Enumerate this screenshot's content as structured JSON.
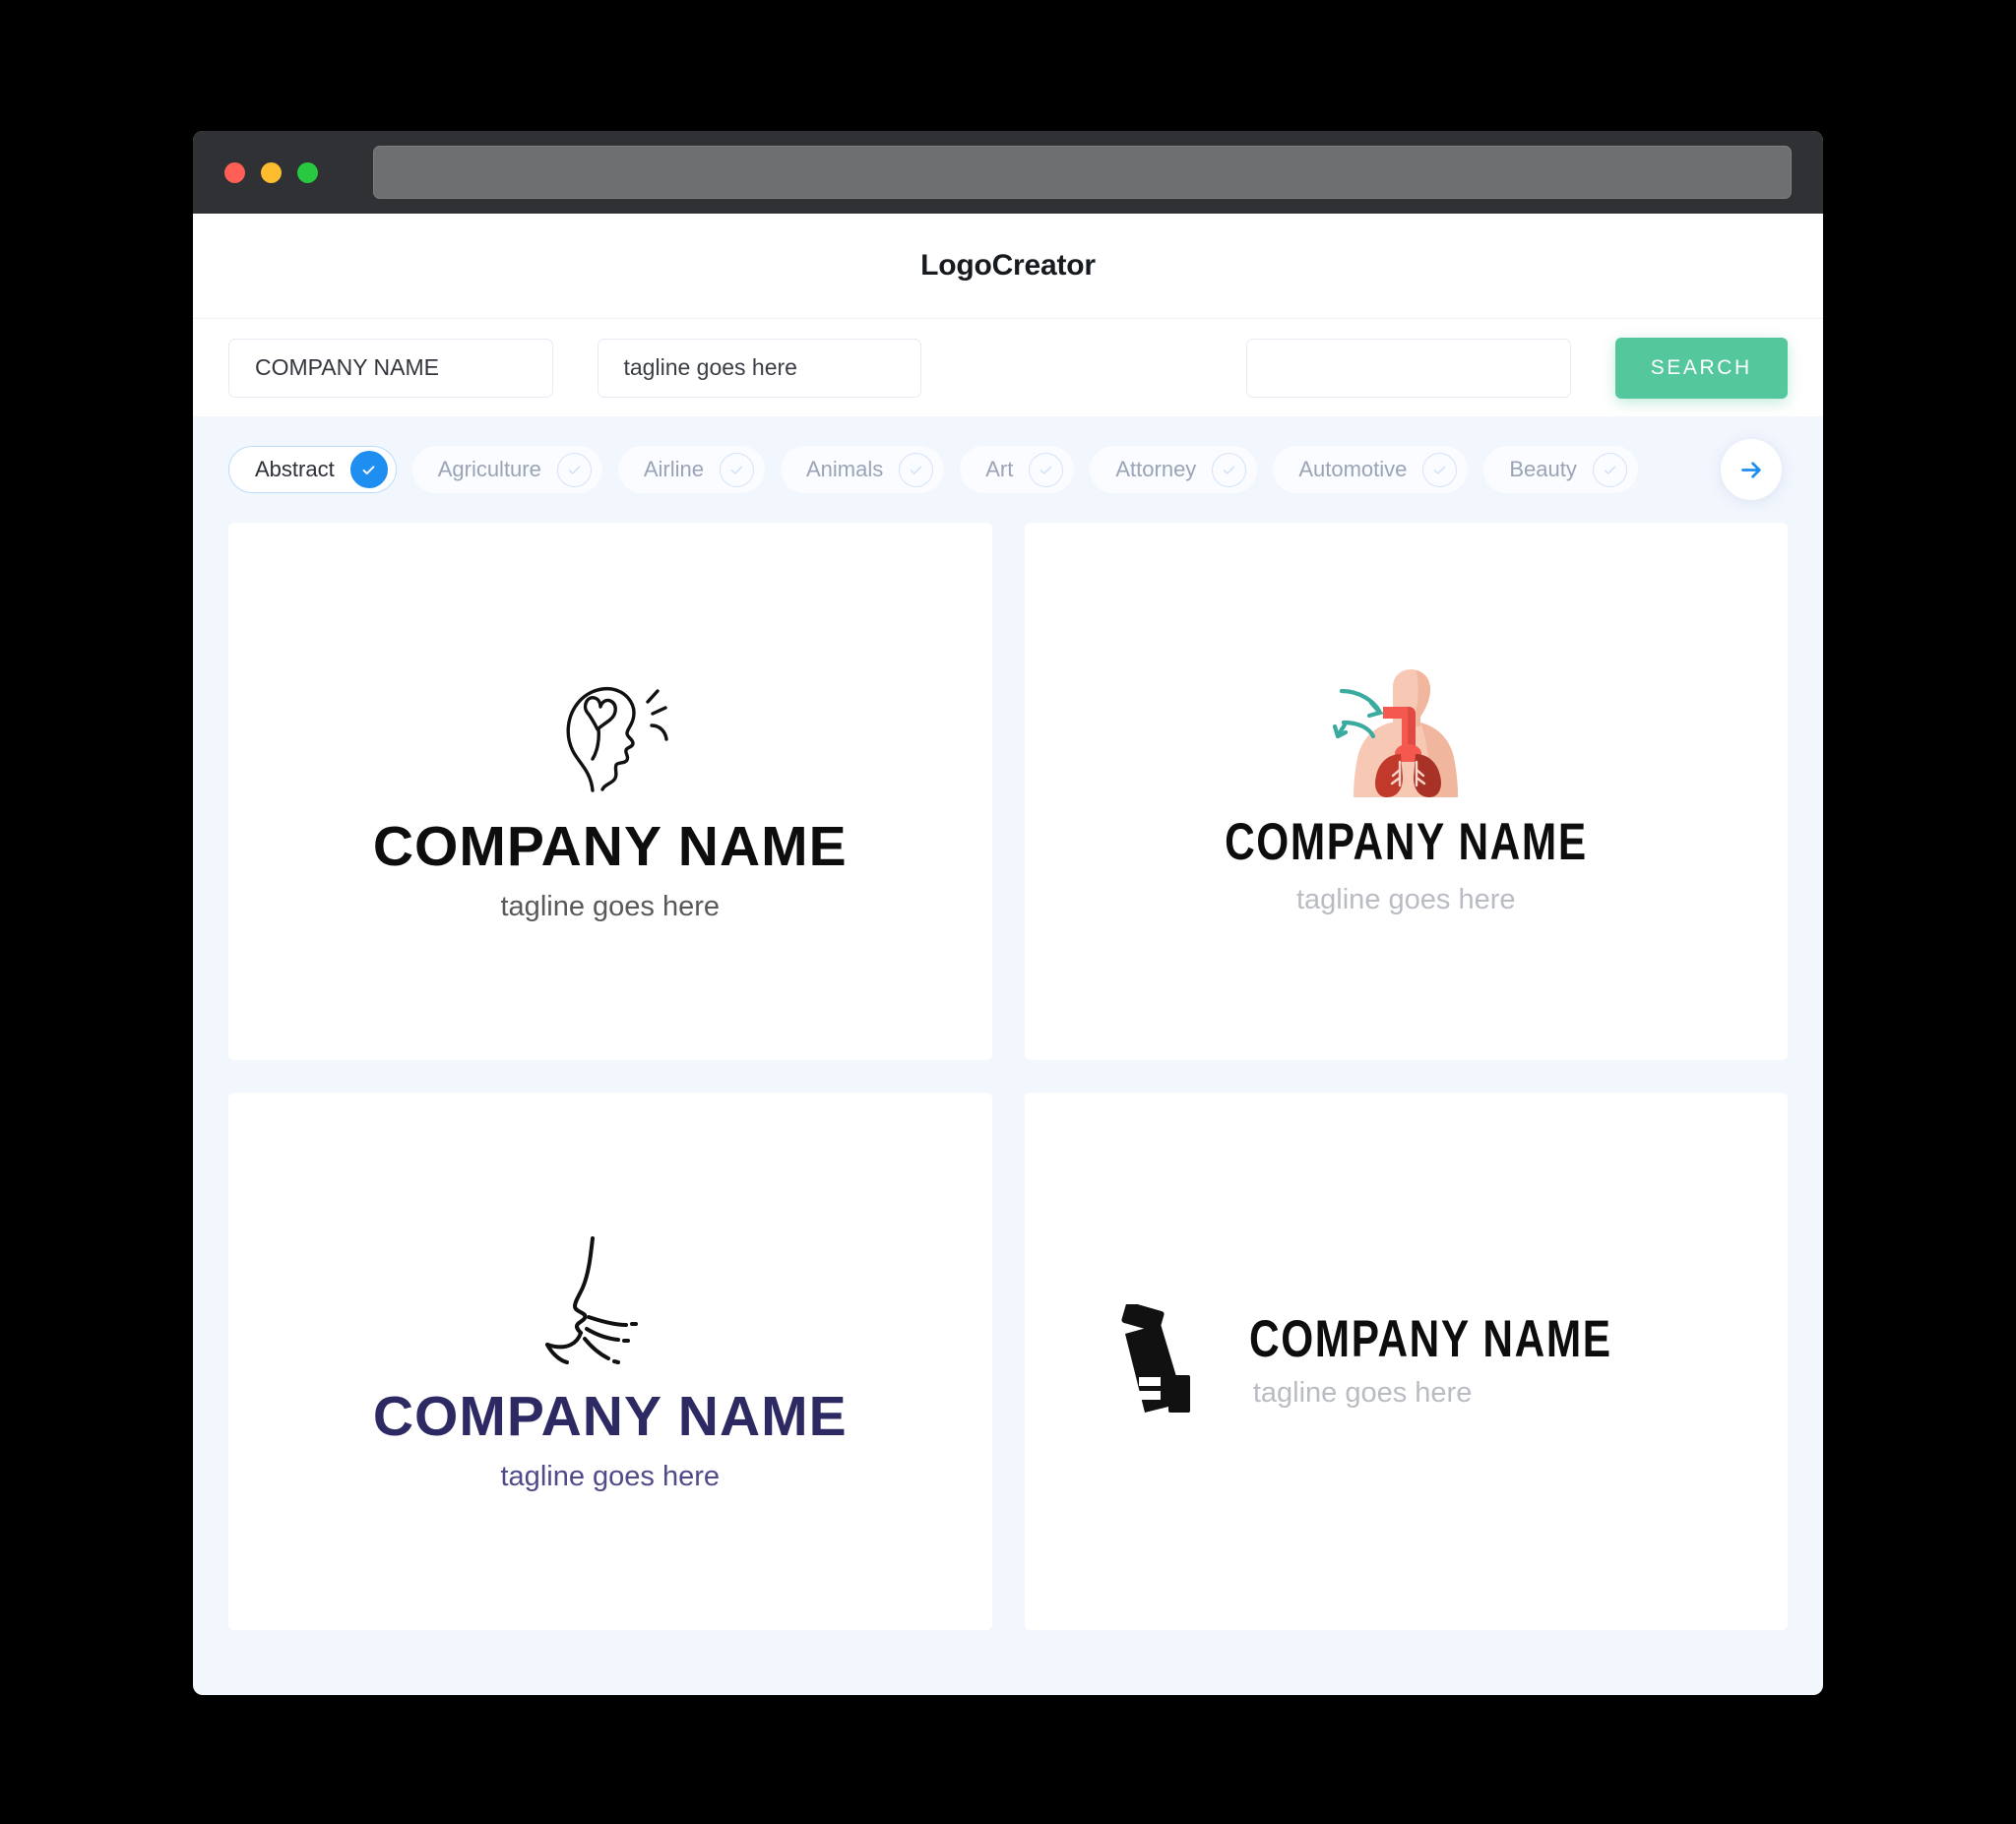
{
  "browser": {
    "url_value": "",
    "traffic_lights": [
      "close-red",
      "minimize-yellow",
      "maximize-green"
    ]
  },
  "header": {
    "title": "LogoCreator"
  },
  "search": {
    "company_value": "COMPANY NAME",
    "tagline_value": "tagline goes here",
    "third_value": "",
    "search_button_label": "SEARCH"
  },
  "categories": {
    "items": [
      {
        "label": "Abstract",
        "selected": true
      },
      {
        "label": "Agriculture",
        "selected": false
      },
      {
        "label": "Airline",
        "selected": false
      },
      {
        "label": "Animals",
        "selected": false
      },
      {
        "label": "Art",
        "selected": false
      },
      {
        "label": "Attorney",
        "selected": false
      },
      {
        "label": "Automotive",
        "selected": false
      },
      {
        "label": "Beauty",
        "selected": false
      }
    ],
    "next_label": "→"
  },
  "results": {
    "cards": [
      {
        "id": "card-head-heart",
        "icon": "head-profile-heart-icon",
        "name": "COMPANY NAME",
        "tagline": "tagline goes here",
        "layout": "stacked",
        "name_color": "#0d0d0d",
        "tagline_color": "#58595b"
      },
      {
        "id": "card-respiratory",
        "icon": "respiratory-lungs-icon",
        "name": "COMPANY NAME",
        "tagline": "tagline goes here",
        "layout": "stacked",
        "name_color": "#0d0d0d",
        "tagline_color": "#b9bcc2"
      },
      {
        "id": "card-face-sneeze",
        "icon": "face-profile-sneeze-icon",
        "name": "COMPANY NAME",
        "tagline": "tagline goes here",
        "layout": "stacked",
        "name_color": "#2d2a63",
        "tagline_color": "#4e4b88"
      },
      {
        "id": "card-inhaler",
        "icon": "asthma-inhaler-icon",
        "name": "COMPANY NAME",
        "tagline": "tagline goes here",
        "layout": "horizontal",
        "name_color": "#0d0d0d",
        "tagline_color": "#b9bcc2"
      }
    ]
  },
  "colors": {
    "accent_green": "#54c79c",
    "accent_blue": "#1f8ef1",
    "page_bg": "#f2f6fd",
    "titlebar": "#2f3134",
    "navy": "#2d2a63"
  }
}
